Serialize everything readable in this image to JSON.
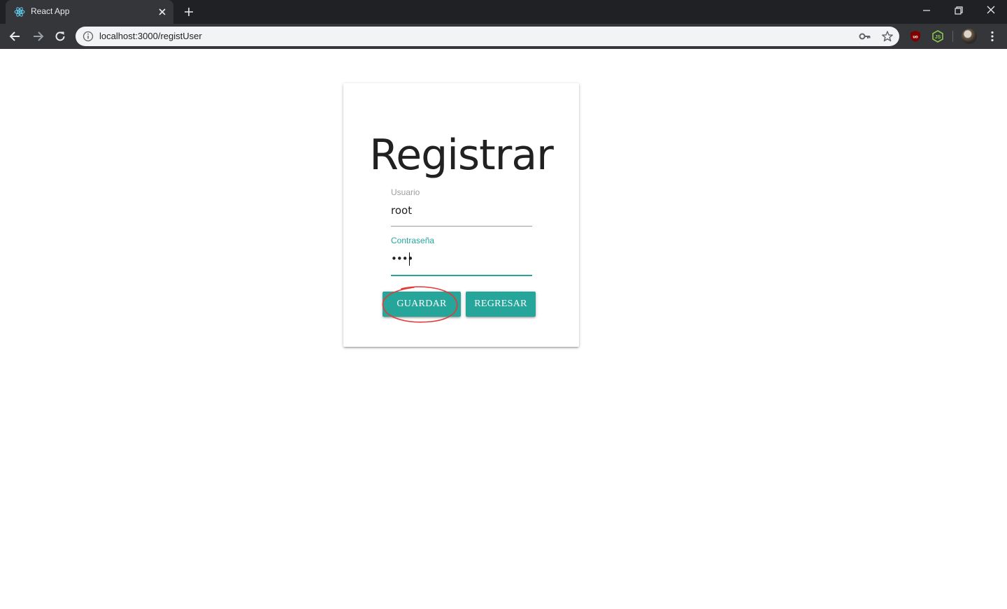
{
  "browser": {
    "tab_title": "React App",
    "url": "localhost:3000/registUser",
    "icons": [
      "react-favicon",
      "close-icon",
      "plus-icon",
      "minimize-icon",
      "restore-icon",
      "window-close-icon",
      "back-arrow-icon",
      "forward-arrow-icon",
      "reload-icon",
      "info-icon",
      "key-icon",
      "star-icon",
      "ublock-icon",
      "nodejs-icon",
      "avatar",
      "kebab-menu-icon"
    ]
  },
  "form": {
    "title": "Registrar",
    "username_label": "Usuario",
    "username_value": "root",
    "password_label": "Contraseña",
    "password_value": "••••",
    "save_label": "GUARDAR",
    "back_label": "REGRESAR"
  },
  "colors": {
    "accent": "#26a69a",
    "annotation": "#e53935",
    "chrome_dark": "#202124",
    "chrome_toolbar": "#35363a"
  }
}
